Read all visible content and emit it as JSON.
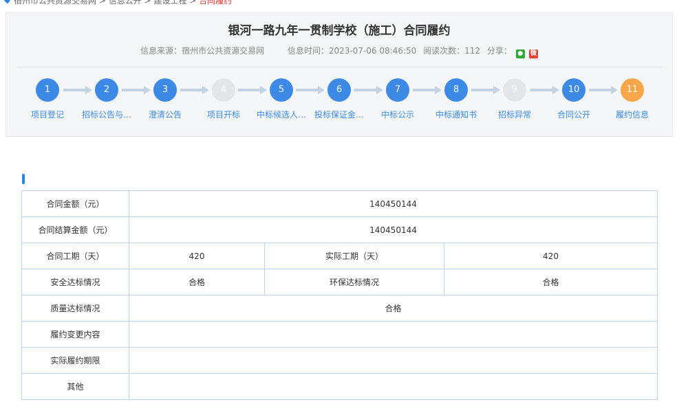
{
  "breadcrumb": {
    "items": [
      "宿州市公共资源交易网",
      "信息公开",
      "建设工程",
      "合同履约"
    ],
    "current": "合同履约"
  },
  "title": "银河一路九年一贯制学校（施工）合同履约",
  "meta": {
    "source": "信息来源：宿州市公共资源交易网",
    "time": "信息时间：2023-07-06 08:46:50",
    "reads": "阅读次数：112",
    "share": "分享：",
    "share_icons": [
      "wechat-icon",
      "weibo-icon"
    ]
  },
  "steps": [
    {
      "num": "1",
      "label": "项目登记",
      "state": "done"
    },
    {
      "num": "2",
      "label": "招标公告与…",
      "state": "done"
    },
    {
      "num": "3",
      "label": "澄清公告",
      "state": "done"
    },
    {
      "num": "4",
      "label": "项目开标",
      "state": "disabled"
    },
    {
      "num": "5",
      "label": "中标候选人…",
      "state": "done"
    },
    {
      "num": "6",
      "label": "投标保证金…",
      "state": "done"
    },
    {
      "num": "7",
      "label": "中标公示",
      "state": "done"
    },
    {
      "num": "8",
      "label": "中标通知书",
      "state": "done"
    },
    {
      "num": "9",
      "label": "招标异常",
      "state": "disabled"
    },
    {
      "num": "10",
      "label": "合同公开",
      "state": "done"
    },
    {
      "num": "11",
      "label": "履约信息",
      "state": "current"
    }
  ],
  "table": {
    "contract_amount_label": "合同金额（元）",
    "contract_amount": "140450144",
    "settlement_amount_label": "合同结算金额（元）",
    "settlement_amount": "140450144",
    "contract_period_label": "合同工期（天）",
    "contract_period": "420",
    "actual_period_label": "实际工期（天）",
    "actual_period": "420",
    "safety_label": "安全达标情况",
    "safety": "合格",
    "env_label": "环保达标情况",
    "env": "合格",
    "quality_label": "质量达标情况",
    "quality": "合格",
    "change_label": "履约变更内容",
    "change": "",
    "actual_deadline_label": "实际履约期限",
    "actual_deadline": "",
    "other_label": "其他",
    "other": ""
  },
  "colors": {
    "accent": "#3d8ae6",
    "current": "#f7a74a",
    "disabled": "#e3e5e8",
    "border": "#bcd3ee"
  }
}
